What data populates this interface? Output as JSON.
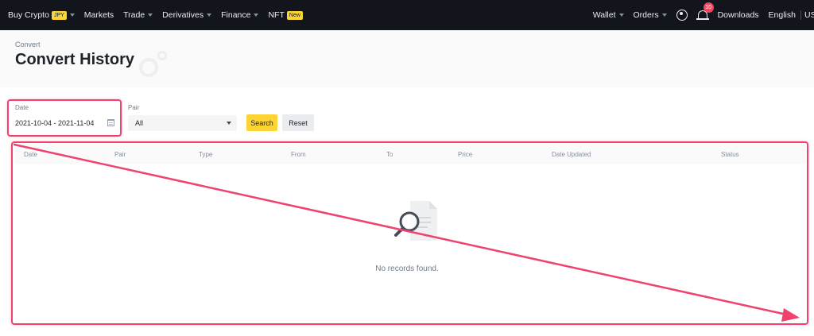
{
  "nav": {
    "buy_crypto": "Buy Crypto",
    "buy_crypto_badge": "JPY",
    "markets": "Markets",
    "trade": "Trade",
    "derivatives": "Derivatives",
    "finance": "Finance",
    "nft": "NFT",
    "nft_badge": "New",
    "wallet": "Wallet",
    "orders": "Orders",
    "notification_count": "10",
    "downloads": "Downloads",
    "language": "English",
    "currency": "US"
  },
  "header": {
    "breadcrumb": "Convert",
    "title": "Convert History"
  },
  "filters": {
    "date_label": "Date",
    "date_value": "2021-10-04 - 2021-11-04",
    "pair_label": "Pair",
    "pair_value": "All",
    "search_label": "Search",
    "reset_label": "Reset"
  },
  "table": {
    "columns": [
      "Date",
      "Pair",
      "Type",
      "From",
      "To",
      "Price",
      "Date Updated",
      "Status"
    ],
    "empty_text": "No records found."
  },
  "colors": {
    "nav_bg": "#12161c",
    "accent": "#fcd535",
    "annotation": "#f0426e"
  }
}
